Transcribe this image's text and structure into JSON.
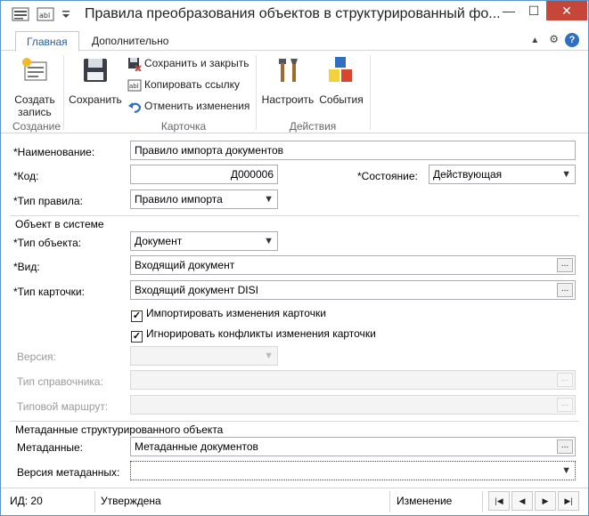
{
  "window": {
    "title": "Правила преобразования объектов в структурированный фо...",
    "minimize": "—",
    "maximize": "☐",
    "close": "✕"
  },
  "tabs": [
    {
      "label": "Главная",
      "active": true
    },
    {
      "label": "Дополнительно",
      "active": false
    }
  ],
  "ribbon": {
    "create_label": "Создать запись",
    "save_label": "Сохранить",
    "save_close_label": "Сохранить и закрыть",
    "copy_link_label": "Копировать ссылку",
    "cancel_changes_label": "Отменить изменения",
    "settings_label": "Настроить",
    "events_label": "События",
    "groups": {
      "create": "Создание",
      "card": "Карточка",
      "actions": "Действия"
    }
  },
  "form": {
    "name_label": "*Наименование:",
    "name_value": "Правило импорта документов",
    "code_label": "*Код:",
    "code_value": "Д000006",
    "state_label": "*Состояние:",
    "state_value": "Действующая",
    "rule_type_label": "*Тип правила:",
    "rule_type_value": "Правило импорта",
    "object_section": "Объект в системе",
    "object_type_label": "*Тип объекта:",
    "object_type_value": "Документ",
    "kind_label": "*Вид:",
    "kind_value": "Входящий документ",
    "card_type_label": "*Тип карточки:",
    "card_type_value": "Входящий документ DISI",
    "import_changes_label": "Импортировать изменения карточки",
    "import_changes_checked": true,
    "ignore_conflicts_label": "Игнорировать конфликты изменения карточки",
    "ignore_conflicts_checked": true,
    "version_label": "Версия:",
    "version_value": "",
    "ref_type_label": "Тип справочника:",
    "ref_type_value": "",
    "route_label": "Типовой маршрут:",
    "route_value": "",
    "meta_section": "Метаданные структурированного объекта",
    "meta_label": "Метаданные:",
    "meta_value": "Метаданные документов",
    "meta_version_label": "Версия метаданных:",
    "meta_version_value": "",
    "ellipsis": "..."
  },
  "status": {
    "id": "ИД: 20",
    "state": "Утверждена",
    "mode": "Изменение"
  },
  "colors": {
    "accent": "#1f5fa8",
    "close": "#c7463a",
    "frame": "#5d93c7"
  }
}
